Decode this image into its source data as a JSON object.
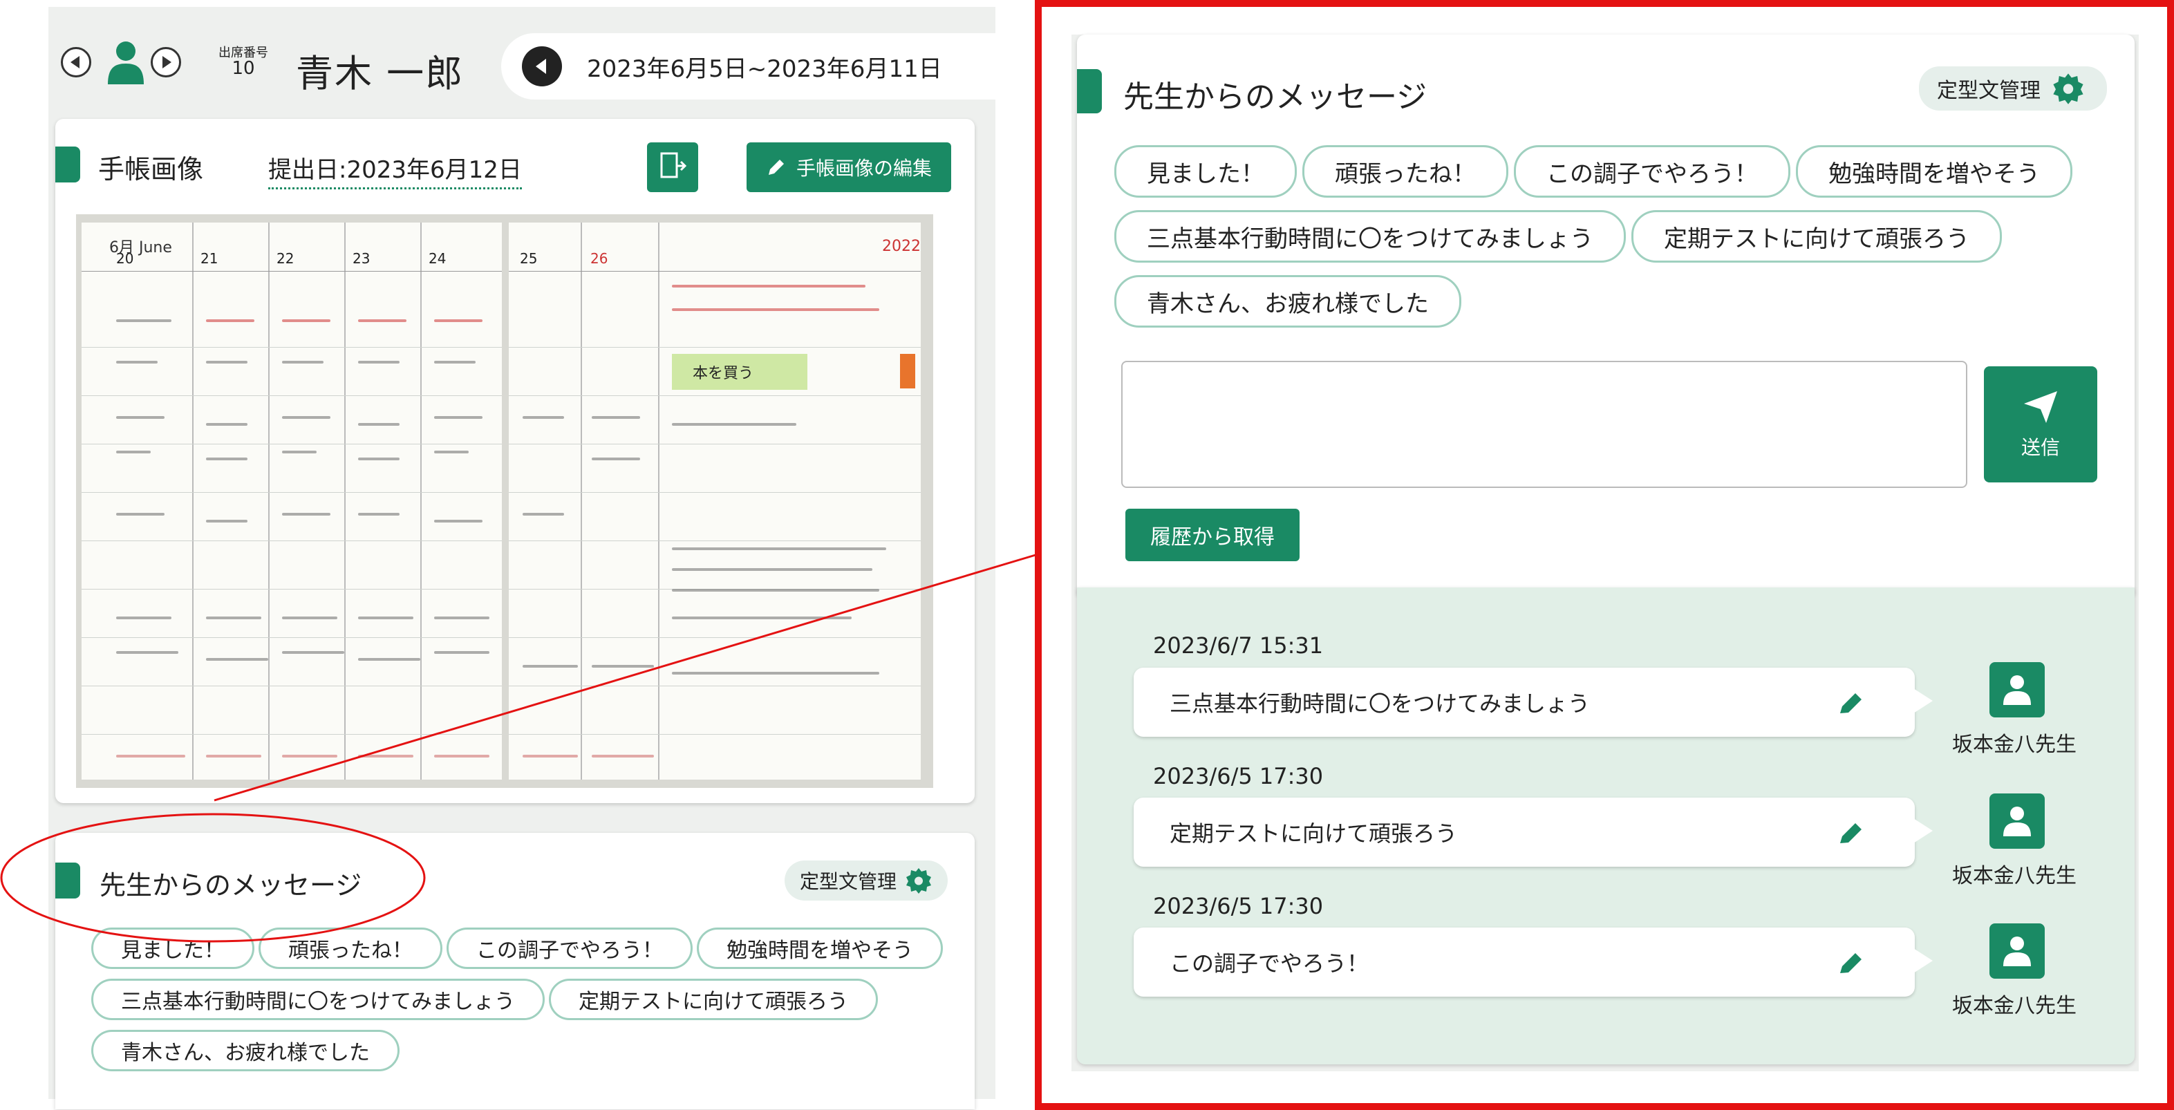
{
  "student": {
    "attendance_label": "出席番号",
    "attendance_number": "10",
    "name": "青木 一郎"
  },
  "period": {
    "range": "2023年6月5日~2023年6月11日"
  },
  "notebook_card": {
    "title": "手帳画像",
    "submitted": "提出日:2023年6月12日",
    "edit_label": "手帳画像の編集"
  },
  "notebook_image": {
    "month": "6月 June",
    "year": "2022",
    "days": [
      "20",
      "21",
      "22",
      "23",
      "24",
      "25",
      "26"
    ],
    "memo": "本を買う"
  },
  "message_card": {
    "title": "先生からのメッセージ",
    "template_mgmt": "定型文管理",
    "chips": [
      "見ました！",
      "頑張ったね！",
      "この調子でやろう！",
      "勉強時間を増やそう",
      "三点基本行動時間に〇をつけてみましょう",
      "定期テストに向けて頑張ろう",
      "青木さん、お疲れ様でした"
    ],
    "input_placeholder": "",
    "send_label": "送信",
    "history_button": "履歴から取得"
  },
  "history": [
    {
      "date": "2023/6/7 15:31",
      "message": "三点基本行動時間に〇をつけてみましょう",
      "teacher": "坂本金八先生"
    },
    {
      "date": "2023/6/5 17:30",
      "message": "定期テストに向けて頑張ろう",
      "teacher": "坂本金八先生"
    },
    {
      "date": "2023/6/5 17:30",
      "message": "この調子でやろう！",
      "teacher": "坂本金八先生"
    }
  ],
  "colors": {
    "accent": "#1a8a64",
    "chip_border": "#9fd0bf",
    "history_bg": "#e1efe7",
    "highlight_frame": "#e41212"
  },
  "icons": [
    "prev-student-icon",
    "student-avatar-icon",
    "next-student-icon",
    "prev-week-icon",
    "rotate-image-icon",
    "pencil-icon",
    "gear-icon",
    "send-plane-icon",
    "teacher-avatar-icon"
  ]
}
